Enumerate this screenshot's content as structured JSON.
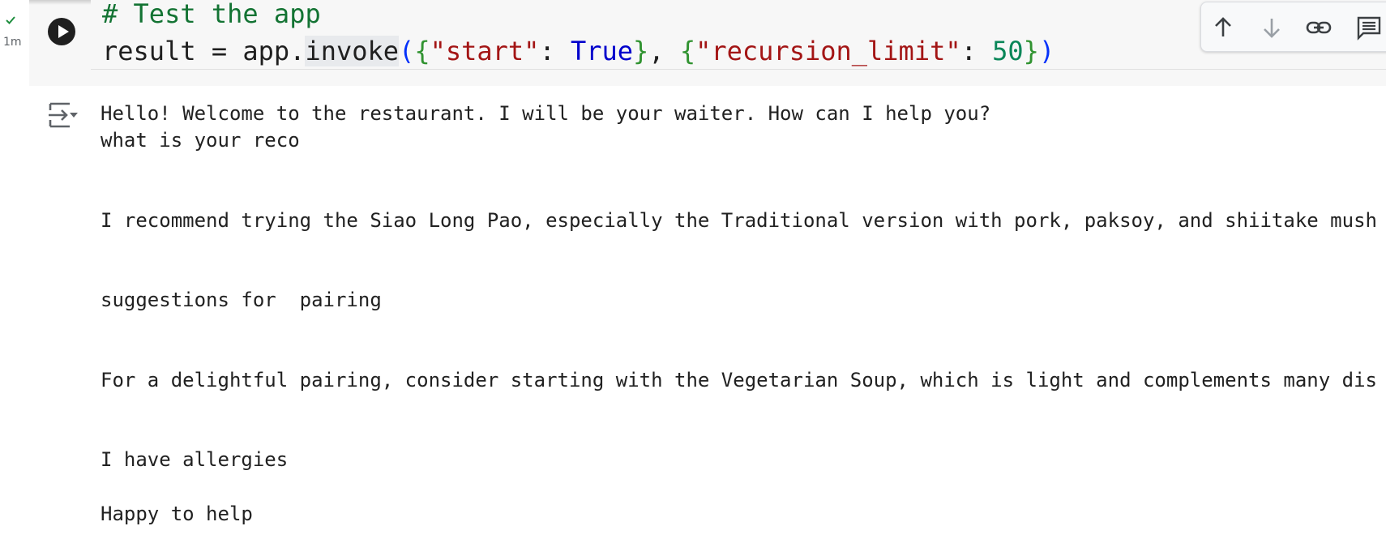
{
  "gutter": {
    "exec_time": "1m"
  },
  "code": {
    "comment": "# Test the app",
    "line2": {
      "var": "result",
      "eq": " = ",
      "obj": "app.",
      "method": "invoke",
      "open_paren": "(",
      "open_brace1": "{",
      "key1": "\"start\"",
      "colon1": ": ",
      "val1": "True",
      "close_brace1": "}",
      "comma": ", ",
      "open_brace2": "{",
      "key2": "\"recursion_limit\"",
      "colon2": ": ",
      "val2": "50",
      "close_brace2": "}",
      "close_paren": ")"
    }
  },
  "toolbar": {
    "icons": [
      "arrow-up-icon",
      "arrow-down-icon",
      "link-icon",
      "comment-icon"
    ]
  },
  "output": {
    "lines": [
      "Hello! Welcome to the restaurant. I will be your waiter. How can I help you?",
      "what is your reco",
      "I recommend trying the Siao Long Pao, especially the Traditional version with pork, paksoy, and shiitake mush",
      "suggestions for  pairing",
      "For a delightful pairing, consider starting with the Vegetarian Soup, which is light and complements many dis",
      "I have allergies",
      "Happy to help"
    ]
  },
  "colors": {
    "comment": "#137333",
    "string": "#a31515",
    "keyword": "#0000cc",
    "number": "#098658"
  }
}
